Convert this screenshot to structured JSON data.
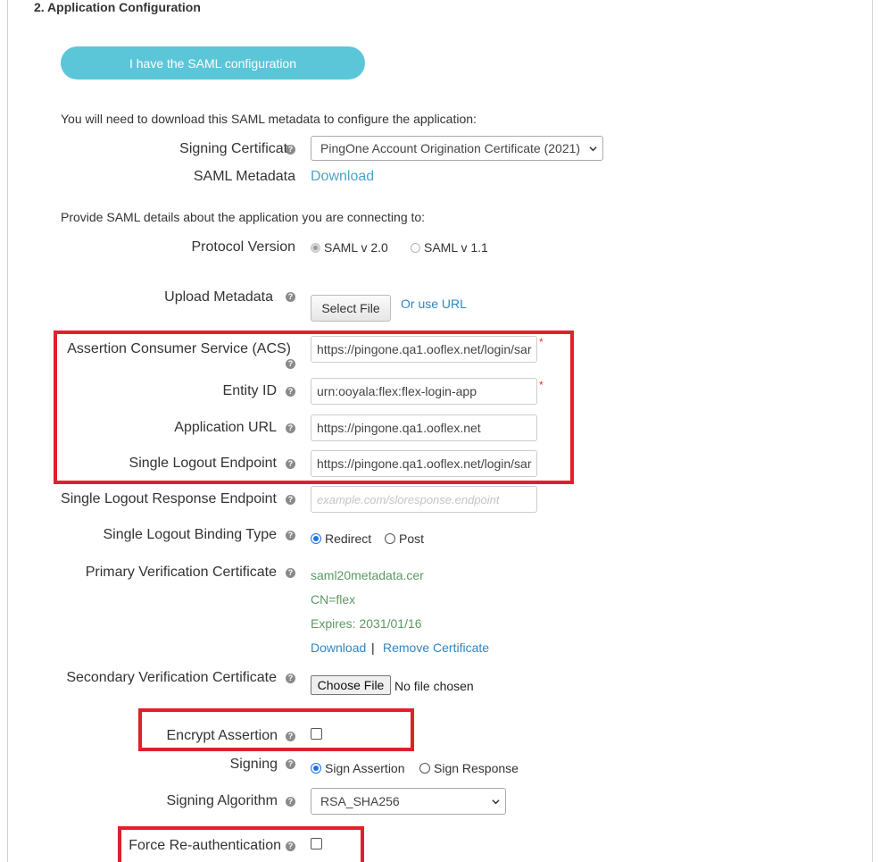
{
  "section_title": "2. Application Configuration",
  "saml_config_button": "I have the SAML configuration",
  "download_intro": "You will need to download this SAML metadata to configure the application:",
  "signing_certificate": {
    "label": "Signing Certificate",
    "value": "PingOne Account Origination Certificate (2021)"
  },
  "saml_metadata": {
    "label": "SAML Metadata",
    "link": "Download"
  },
  "provide_intro": "Provide SAML details about the application you are connecting to:",
  "protocol_version": {
    "label": "Protocol Version",
    "options": [
      "SAML v 2.0",
      "SAML v 1.1"
    ],
    "selected": "SAML v 2.0"
  },
  "upload_metadata": {
    "label": "Upload Metadata",
    "button": "Select File",
    "alt_link": "Or use URL"
  },
  "acs": {
    "label": "Assertion Consumer Service (ACS)",
    "value": "https://pingone.qa1.ooflex.net/login/sar",
    "required_mark": "*"
  },
  "entity_id": {
    "label": "Entity ID",
    "value": "urn:ooyala:flex:flex-login-app",
    "required_mark": "*"
  },
  "application_url": {
    "label": "Application URL",
    "value": "https://pingone.qa1.ooflex.net"
  },
  "single_logout_endpoint": {
    "label": "Single Logout Endpoint",
    "value": "https://pingone.qa1.ooflex.net/login/sar"
  },
  "single_logout_response_endpoint": {
    "label": "Single Logout Response Endpoint",
    "placeholder": "example.com/sloresponse.endpoint"
  },
  "single_logout_binding": {
    "label": "Single Logout Binding Type",
    "options": [
      "Redirect",
      "Post"
    ],
    "selected": "Redirect"
  },
  "primary_cert": {
    "label": "Primary Verification Certificate",
    "filename": "saml20metadata.cer",
    "cn": "CN=flex",
    "expires": "Expires: 2031/01/16",
    "download": "Download",
    "separator": "|",
    "remove": "Remove Certificate"
  },
  "secondary_cert": {
    "label": "Secondary Verification Certificate",
    "button": "Choose File",
    "status": "No file chosen"
  },
  "encrypt_assertion": {
    "label": "Encrypt Assertion",
    "checked": false
  },
  "signing": {
    "label": "Signing",
    "options": [
      "Sign Assertion",
      "Sign Response"
    ],
    "selected": "Sign Assertion"
  },
  "signing_algorithm": {
    "label": "Signing Algorithm",
    "value": "RSA_SHA256"
  },
  "force_reauth": {
    "label": "Force Re-authentication",
    "checked": false
  },
  "help_glyph": "?",
  "colors": {
    "accent_button": "#5bc6d8",
    "link": "#4aa3c9",
    "cert_text": "#5a9a63",
    "highlight_box": "#e0202a",
    "radio_selected": "#1a73e8"
  }
}
